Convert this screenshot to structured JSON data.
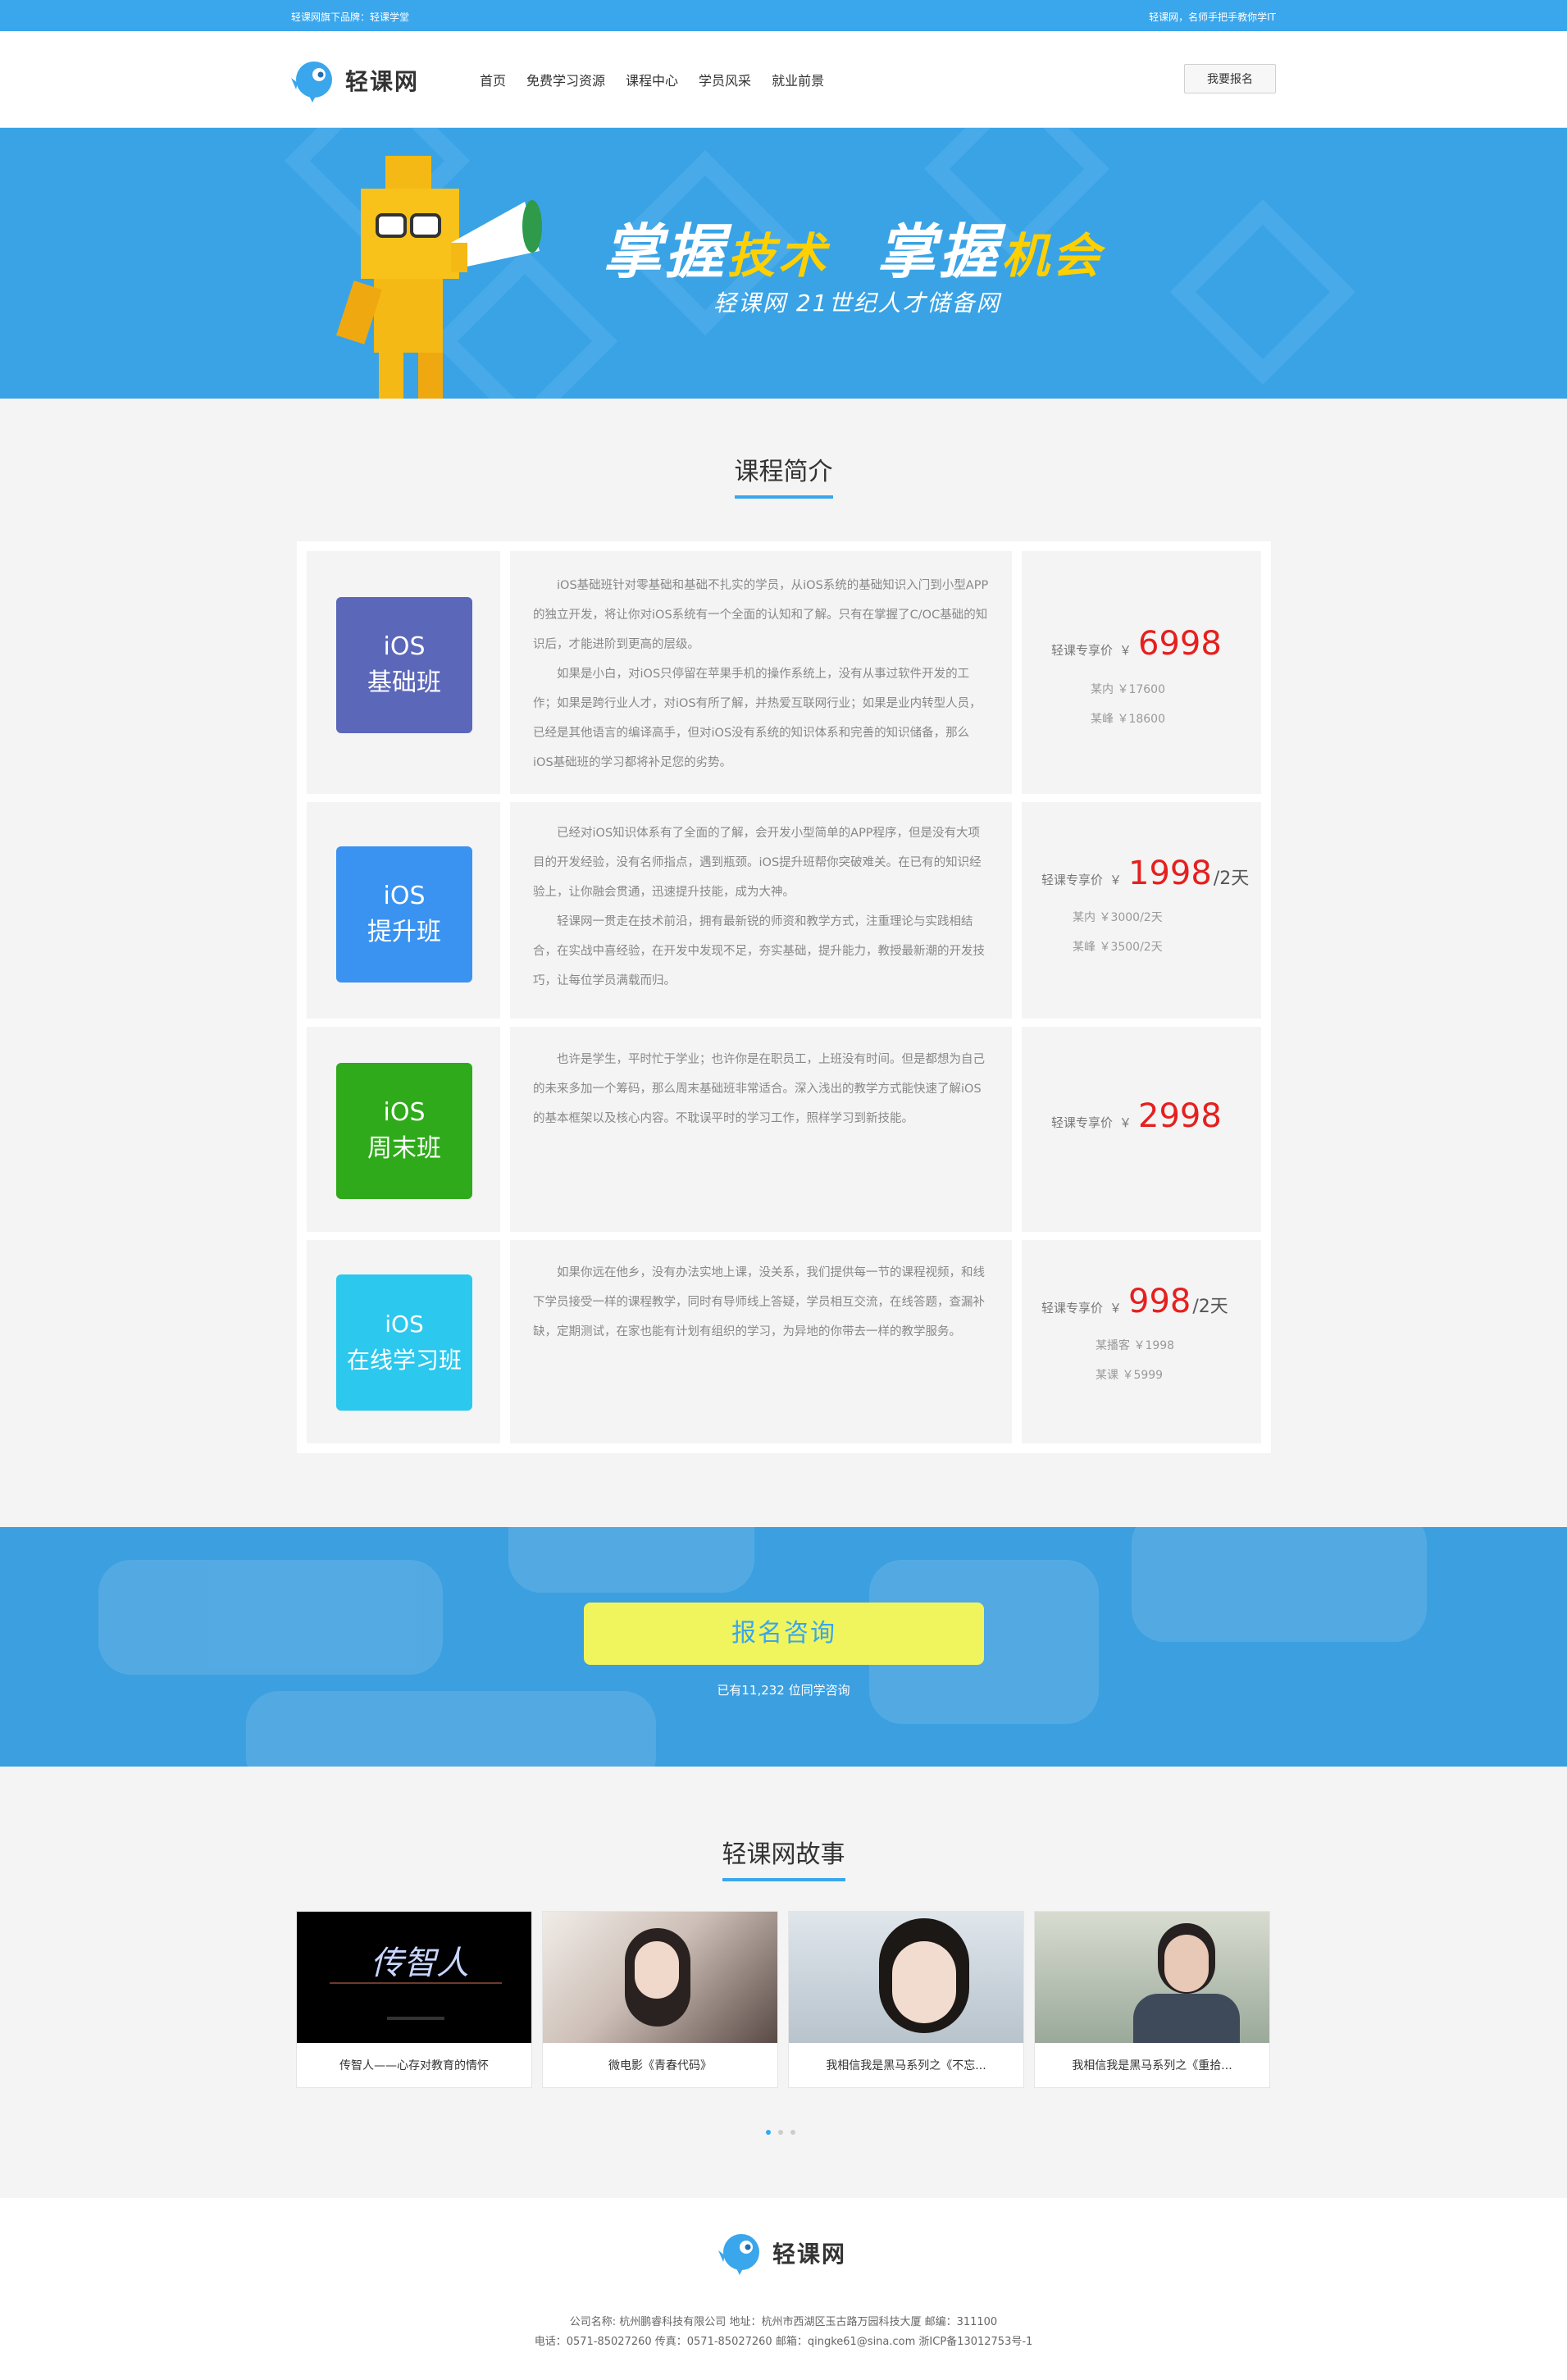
{
  "topbar": {
    "left": "轻课网旗下品牌：轻课学堂",
    "right": "轻课网，名师手把手教你学IT"
  },
  "header": {
    "logo_text": "轻课网",
    "nav": [
      "首页",
      "免费学习资源",
      "课程中心",
      "学员风采",
      "就业前景"
    ],
    "signup": "我要报名"
  },
  "banner": {
    "slogan_part1_a": "掌握",
    "slogan_part1_b": "技术",
    "slogan_part2_a": "掌握",
    "slogan_part2_b": "机会",
    "subtitle": "轻课网 21世纪人才储备网"
  },
  "courses": {
    "title": "课程简介",
    "items": [
      {
        "badge_line1": "iOS",
        "badge_line2": "基础班",
        "badge_color": "#5b67b8",
        "desc": [
          "iOS基础班针对零基础和基础不扎实的学员，从iOS系统的基础知识入门到小型APP的独立开发，将让你对iOS系统有一个全面的认知和了解。只有在掌握了C/OC基础的知识后，才能进阶到更高的层级。",
          "如果是小白，对iOS只停留在苹果手机的操作系统上，没有从事过软件开发的工作；如果是跨行业人才，对iOS有所了解，并热爱互联网行业；如果是业内转型人员，已经是其他语言的编译高手，但对iOS没有系统的知识体系和完善的知识储备，那么iOS基础班的学习都将补足您的劣势。"
        ],
        "price_label": "轻课专享价",
        "currency": "￥",
        "price": "6998",
        "unit": "",
        "others": [
          "某内 ￥17600",
          "某峰 ￥18600"
        ]
      },
      {
        "badge_line1": "iOS",
        "badge_line2": "提升班",
        "badge_color": "#3a93f0",
        "desc": [
          "已经对iOS知识体系有了全面的了解，会开发小型简单的APP程序，但是没有大项目的开发经验，没有名师指点，遇到瓶颈。iOS提升班帮你突破难关。在已有的知识经验上，让你融会贯通，迅速提升技能，成为大神。",
          "轻课网一贯走在技术前沿，拥有最新锐的师资和教学方式，注重理论与实践相结合，在实战中喜经验，在开发中发现不足，夯实基础，提升能力，教授最新潮的开发技巧，让每位学员满载而归。"
        ],
        "price_label": "轻课专享价",
        "currency": "￥",
        "price": "1998",
        "unit": "/2天",
        "others": [
          "某内 ￥3000/2天",
          "某峰 ￥3500/2天"
        ]
      },
      {
        "badge_line1": "iOS",
        "badge_line2": "周末班",
        "badge_color": "#2faa1a",
        "desc": [
          "也许是学生，平时忙于学业；也许你是在职员工，上班没有时间。但是都想为自己的未来多加一个筹码，那么周末基础班非常适合。深入浅出的教学方式能快速了解iOS的基本框架以及核心内容。不耽误平时的学习工作，照样学习到新技能。"
        ],
        "price_label": "轻课专享价",
        "currency": "￥",
        "price": "2998",
        "unit": "",
        "others": []
      },
      {
        "badge_line1": "iOS",
        "badge_line2": "在线学习班",
        "badge_color": "#2cc8ee",
        "desc": [
          "如果你远在他乡，没有办法实地上课，没关系，我们提供每一节的课程视频，和线下学员接受一样的课程教学，同时有导师线上答疑，学员相互交流，在线答题，查漏补缺，定期测试，在家也能有计划有组织的学习，为异地的你带去一样的教学服务。"
        ],
        "price_label": "轻课专享价",
        "currency": "￥",
        "price": "998",
        "unit": "/2天",
        "others": [
          "某播客 ￥1998",
          "某课 ￥5999"
        ]
      }
    ]
  },
  "cta": {
    "button": "报名咨询",
    "count_text": "已有11,232 位同学咨询"
  },
  "stories": {
    "title": "轻课网故事",
    "items": [
      {
        "caption": "传智人——心存对教育的情怀",
        "img_text": "传智人"
      },
      {
        "caption": "微电影《青春代码》"
      },
      {
        "caption": "我相信我是黑马系列之《不忘..."
      },
      {
        "caption": "我相信我是黑马系列之《重拾..."
      }
    ]
  },
  "footer": {
    "logo_text": "轻课网",
    "line1": "公司名称: 杭州鹏睿科技有限公司    地址：杭州市西湖区玉古路万园科技大厦  邮编：311100",
    "line2": "电话：0571-85027260    传真：0571-85027260    邮箱：qingke61@sina.com    浙ICP备13012753号-1"
  },
  "colors": {
    "primary": "#3aa6ec",
    "price_red": "#e5201e",
    "cta_yellow": "#f0f55e"
  }
}
